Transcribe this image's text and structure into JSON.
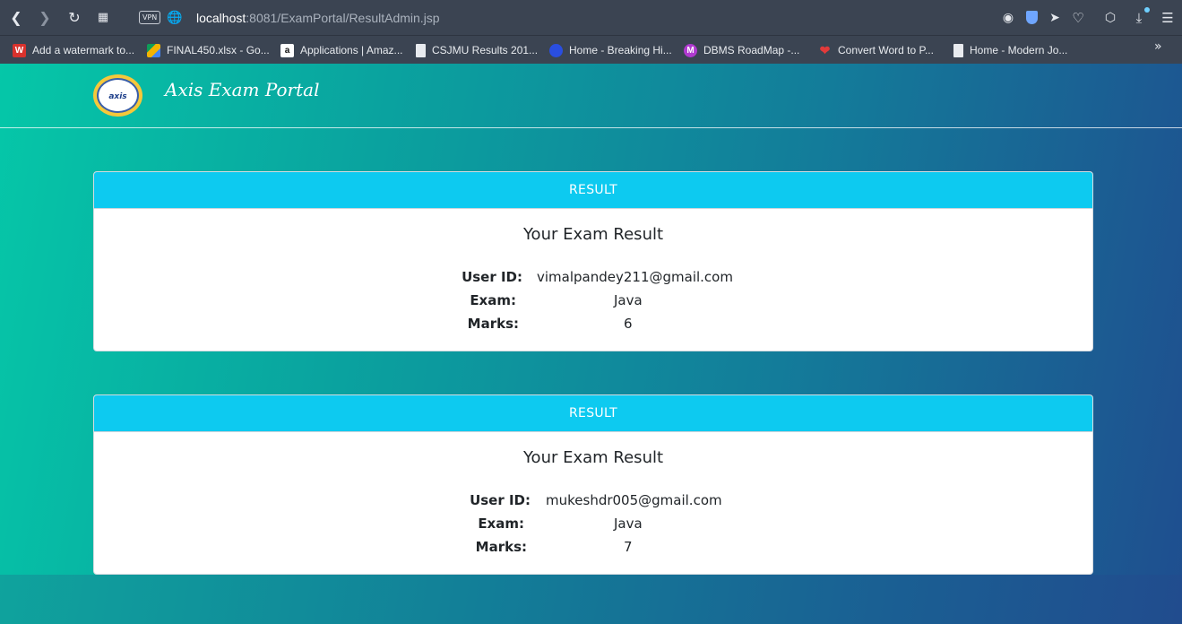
{
  "browser": {
    "url_host": "localhost",
    "url_rest": ":8081/ExamPortal/ResultAdmin.jsp",
    "vpn_label": "VPN",
    "bookmarks": [
      {
        "label": "Add a watermark to...",
        "icon": "watermark-icon",
        "color": "#d8322d"
      },
      {
        "label": "FINAL450.xlsx - Go...",
        "icon": "google-drive-icon",
        "color": "#f4b400"
      },
      {
        "label": "Applications | Amaz...",
        "icon": "amazon-icon",
        "color": "#ffffff"
      },
      {
        "label": "CSJMU Results 201...",
        "icon": "file-icon",
        "color": "#e8ebef"
      },
      {
        "label": "Home - Breaking Hi...",
        "icon": "globe-icon",
        "color": "#2a4ee0"
      },
      {
        "label": "DBMS RoadMap -...",
        "icon": "m-icon",
        "color": "#b03ad0"
      },
      {
        "label": "Convert Word to P...",
        "icon": "heart-icon",
        "color": "#e23a3a"
      },
      {
        "label": "Home - Modern Jo...",
        "icon": "file-icon",
        "color": "#e8ebef"
      }
    ]
  },
  "navbar": {
    "brand": "Axis Exam Portal",
    "logo_text": "axis"
  },
  "results": [
    {
      "header": "RESULT",
      "title": "Your Exam Result",
      "user_id_label": "User ID:",
      "user_id": "vimalpandey211@gmail.com",
      "exam_label": "Exam:",
      "exam": "Java",
      "marks_label": "Marks:",
      "marks": "6"
    },
    {
      "header": "RESULT",
      "title": "Your Exam Result",
      "user_id_label": "User ID:",
      "user_id": "mukeshdr005@gmail.com",
      "exam_label": "Exam:",
      "exam": "Java",
      "marks_label": "Marks:",
      "marks": "7"
    }
  ]
}
